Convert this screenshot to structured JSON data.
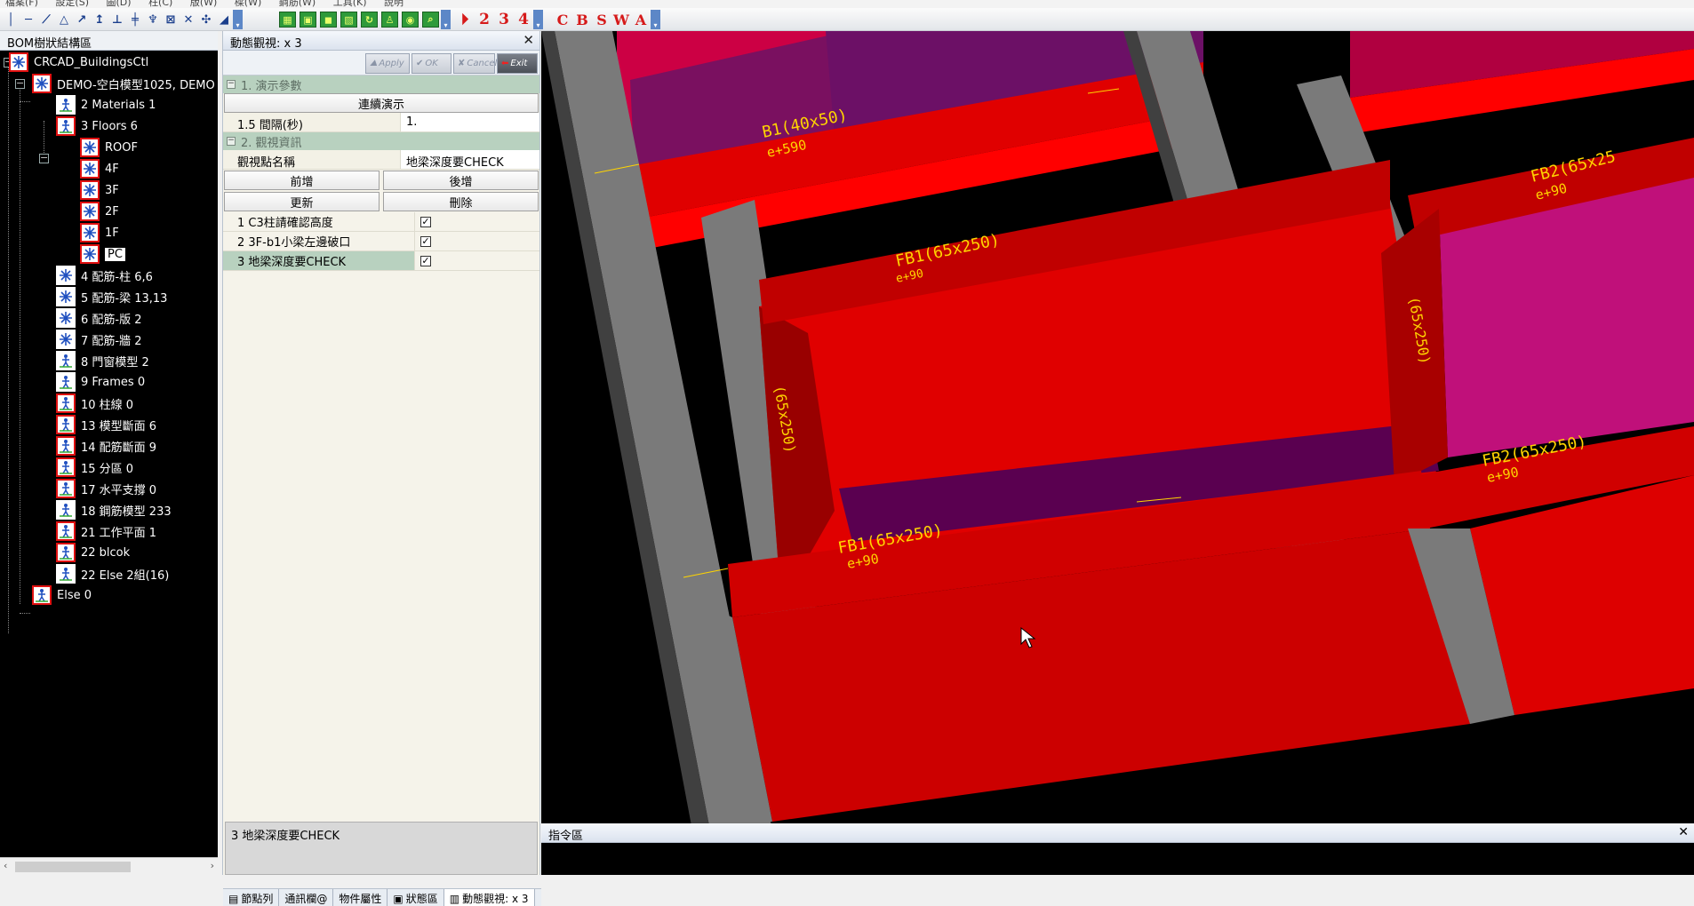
{
  "menubar": {
    "items": [
      "檔案(F)",
      "設定(S)",
      "圖(D)",
      "柱(C)",
      "版(W)",
      "樑(W)",
      "鋼筋(W)",
      "工具(K)",
      "說明"
    ]
  },
  "toolbar": {
    "numbers": [
      "2",
      "3",
      "4"
    ],
    "letters": [
      "C",
      "B",
      "S",
      "W",
      "A"
    ]
  },
  "bom": {
    "title": "BOM樹狀結構區",
    "nodes": [
      "CRCAD_BuildingsCtl",
      "DEMO-空白模型1025, DEMO",
      "2 Materials 1",
      "3 Floors 6",
      "ROOF",
      "4F",
      "3F",
      "2F",
      "1F",
      "PC",
      "4 配筋-柱 6,6",
      "5 配筋-梁 13,13",
      "6 配筋-版 2",
      "7 配筋-牆 2",
      "8 門窗模型 2",
      "9 Frames 0",
      "10 柱線 0",
      "13 模型斷面 6",
      "14 配筋斷面 9",
      "15 分區 0",
      "17 水平支撐 0",
      "18 鋼筋模型 233",
      "21 工作平面 1",
      "22 blcok",
      "22 Else 2組(16)",
      "Else 0"
    ]
  },
  "dynamic": {
    "title": "動態觀視: x 3",
    "tools": {
      "apply": "Apply",
      "ok": "OK",
      "cancel": "Cancel",
      "exit": "Exit"
    },
    "section1": "1. 演示參數",
    "continuous_demo": "連續演示",
    "interval_label": "1.5 間隔(秒)",
    "interval_value": "1.",
    "section2": "2. 觀視資訊",
    "viewpoint_name_label": "觀視點名稱",
    "viewpoint_name_value": "地梁深度要CHECK",
    "buttons": {
      "add_before": "前增",
      "add_after": "後增",
      "update": "更新",
      "delete": "刪除"
    },
    "viewpoints": [
      {
        "label": "1 C3柱請確認高度",
        "checked": "✓"
      },
      {
        "label": "2 3F-b1小梁左邊破口",
        "checked": "✓"
      },
      {
        "label": "3 地梁深度要CHECK",
        "checked": "✓"
      }
    ],
    "description": "3 地梁深度要CHECK",
    "bottom_tabs": [
      "節點列",
      "通訊欄@",
      "物件屬性",
      "狀態區",
      "動態觀視: x 3"
    ]
  },
  "viewport": {
    "labels": {
      "b1": "B1(40x50)",
      "b1_sub": "e+590",
      "fb1a": "FB1(65x250)",
      "fb1a_sub": "e+90",
      "fb1b": "FB1(65x250)",
      "fb1b_sub": "e+90",
      "fb2a": "FB2(65x25",
      "fb2a_sub": "e+90",
      "fb2b": "FB2(65x250)",
      "fb2b_sub": "e+90",
      "side_left": "(65x250)",
      "side_right": "(65x250)"
    },
    "colors": {
      "beam_red": "#ff0000",
      "slab_red": "#cc0000",
      "column_gray": "#7a7a7a",
      "purple": "#8a1a6a",
      "label_yellow": "#ffd400"
    }
  },
  "command": {
    "title": "指令區"
  }
}
